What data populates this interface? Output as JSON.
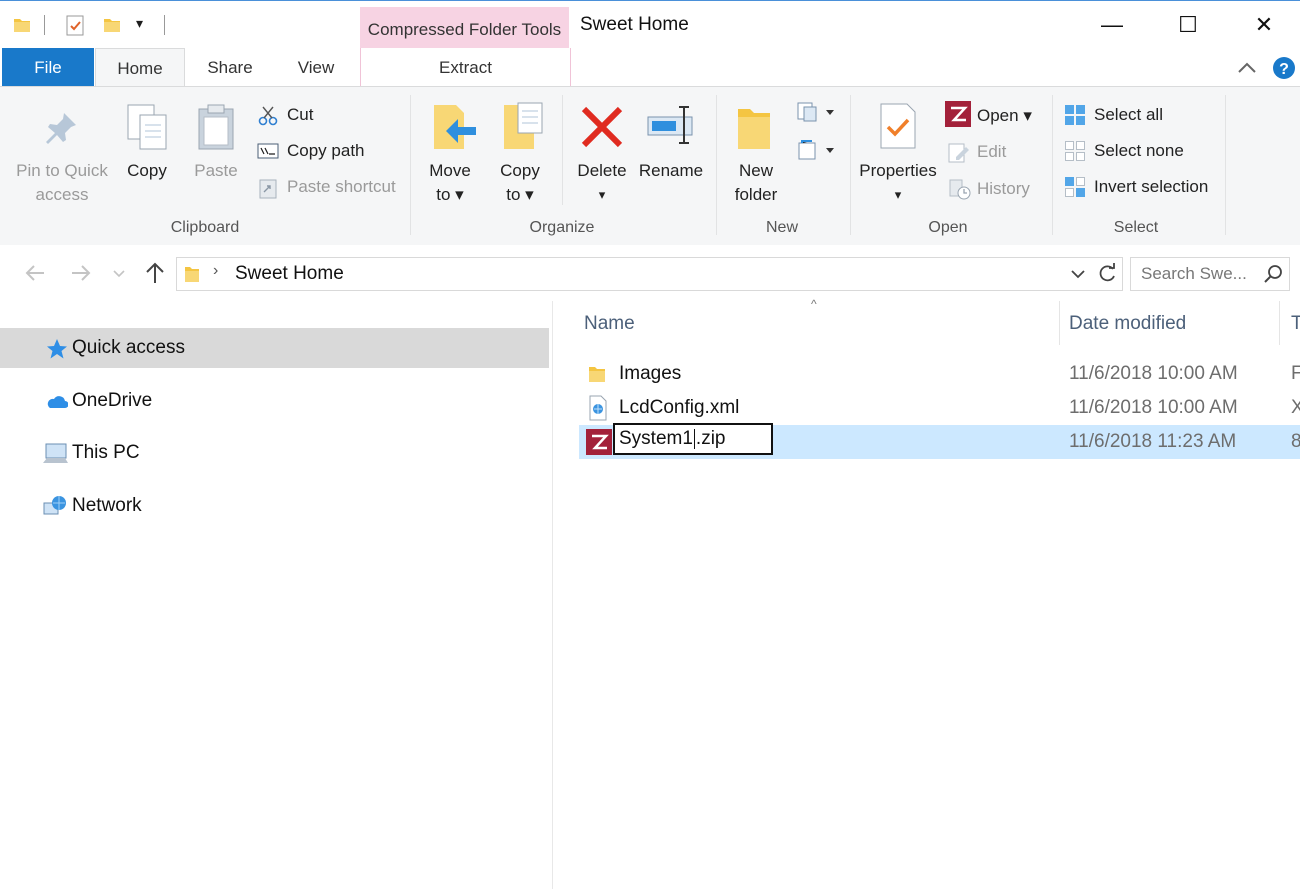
{
  "window": {
    "title": "Sweet Home",
    "contextual_tab_group": "Compressed Folder Tools",
    "controls": {
      "minimize": "—",
      "maximize": "☐",
      "close": "✕"
    }
  },
  "quick_access_toolbar": {
    "dropdown": "▾"
  },
  "tabs": [
    "File",
    "Home",
    "Share",
    "View",
    "Extract"
  ],
  "ribbon": {
    "clipboard": {
      "group": "Clipboard",
      "pin_line1": "Pin to Quick",
      "pin_line2": "access",
      "copy": "Copy",
      "paste": "Paste",
      "cut": "Cut",
      "copy_path": "Copy path",
      "paste_shortcut": "Paste shortcut"
    },
    "organize": {
      "group": "Organize",
      "move_line1": "Move",
      "move_line2": "to",
      "copy_line1": "Copy",
      "copy_line2": "to",
      "delete": "Delete",
      "rename": "Rename"
    },
    "new": {
      "group": "New",
      "folder_line1": "New",
      "folder_line2": "folder"
    },
    "open": {
      "group": "Open",
      "properties": "Properties",
      "open": "Open",
      "edit": "Edit",
      "history": "History"
    },
    "select": {
      "group": "Select",
      "select_all": "Select all",
      "select_none": "Select none",
      "invert": "Invert selection"
    }
  },
  "address": {
    "path": "Sweet Home",
    "search_placeholder": "Search Swe..."
  },
  "nav": [
    {
      "label": "Quick access"
    },
    {
      "label": "OneDrive"
    },
    {
      "label": "This PC"
    },
    {
      "label": "Network"
    }
  ],
  "columns": {
    "name": "Name",
    "date": "Date modified",
    "type": "T"
  },
  "files": [
    {
      "name": "Images",
      "date": "11/6/2018 10:00 AM",
      "type": "F"
    },
    {
      "name": "LcdConfig.xml",
      "date": "11/6/2018 10:00 AM",
      "type": "X"
    },
    {
      "name_before_caret": "System1",
      "name_after_caret": ".zip",
      "date": "11/6/2018 11:23 AM",
      "type": "8"
    }
  ],
  "colors": {
    "file_tab": "#1979ca",
    "context_header": "#f7d3e3",
    "selection": "#cce8ff",
    "nav_selected": "#d9d9d9"
  }
}
